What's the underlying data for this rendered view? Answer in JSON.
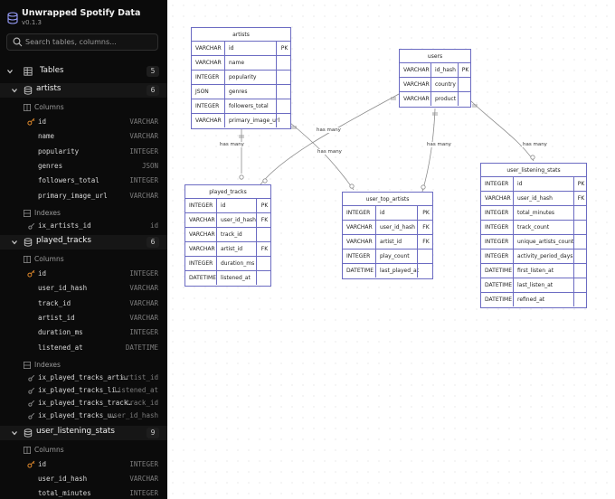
{
  "app": {
    "title": "Unwrapped Spotify Data",
    "version": "v0.1.3"
  },
  "search": {
    "placeholder": "Search tables, columns..."
  },
  "sidebar": {
    "tables_label": "Tables",
    "tables_count": "5",
    "tables": [
      {
        "name": "artists",
        "count": "6",
        "columns_label": "Columns",
        "columns": [
          {
            "name": "id",
            "type": "VARCHAR",
            "key": true
          },
          {
            "name": "name",
            "type": "VARCHAR"
          },
          {
            "name": "popularity",
            "type": "INTEGER"
          },
          {
            "name": "genres",
            "type": "JSON"
          },
          {
            "name": "followers_total",
            "type": "INTEGER"
          },
          {
            "name": "primary_image_url",
            "type": "VARCHAR"
          }
        ],
        "indexes_label": "Indexes",
        "indexes": [
          {
            "name": "ix_artists_id",
            "target": "id"
          }
        ]
      },
      {
        "name": "played_tracks",
        "count": "6",
        "columns_label": "Columns",
        "columns": [
          {
            "name": "id",
            "type": "INTEGER",
            "key": true
          },
          {
            "name": "user_id_hash",
            "type": "VARCHAR"
          },
          {
            "name": "track_id",
            "type": "VARCHAR"
          },
          {
            "name": "artist_id",
            "type": "VARCHAR"
          },
          {
            "name": "duration_ms",
            "type": "INTEGER"
          },
          {
            "name": "listened_at",
            "type": "DATETIME"
          }
        ],
        "indexes_label": "Indexes",
        "indexes": [
          {
            "name": "ix_played_tracks_arti…",
            "target": "artist_id"
          },
          {
            "name": "ix_played_tracks_li…",
            "target": "listened_at"
          },
          {
            "name": "ix_played_tracks_track…",
            "target": "track_id"
          },
          {
            "name": "ix_played_tracks_u…",
            "target": "user_id_hash"
          }
        ]
      },
      {
        "name": "user_listening_stats",
        "count": "9",
        "columns_label": "Columns",
        "columns": [
          {
            "name": "id",
            "type": "INTEGER",
            "key": true
          },
          {
            "name": "user_id_hash",
            "type": "VARCHAR"
          },
          {
            "name": "total_minutes",
            "type": "INTEGER"
          }
        ]
      }
    ]
  },
  "diagram": {
    "entities": {
      "artists": {
        "title": "artists",
        "rows": [
          [
            "VARCHAR",
            "id",
            "PK"
          ],
          [
            "VARCHAR",
            "name",
            ""
          ],
          [
            "INTEGER",
            "popularity",
            ""
          ],
          [
            "JSON",
            "genres",
            ""
          ],
          [
            "INTEGER",
            "followers_total",
            ""
          ],
          [
            "VARCHAR",
            "primary_image_url",
            ""
          ]
        ]
      },
      "users": {
        "title": "users",
        "rows": [
          [
            "VARCHAR",
            "id_hash",
            "PK"
          ],
          [
            "VARCHAR",
            "country",
            ""
          ],
          [
            "VARCHAR",
            "product",
            ""
          ]
        ]
      },
      "played_tracks": {
        "title": "played_tracks",
        "rows": [
          [
            "INTEGER",
            "id",
            "PK"
          ],
          [
            "VARCHAR",
            "user_id_hash",
            "FK"
          ],
          [
            "VARCHAR",
            "track_id",
            ""
          ],
          [
            "VARCHAR",
            "artist_id",
            "FK"
          ],
          [
            "INTEGER",
            "duration_ms",
            ""
          ],
          [
            "DATETIME",
            "listened_at",
            ""
          ]
        ]
      },
      "user_top_artists": {
        "title": "user_top_artists",
        "rows": [
          [
            "INTEGER",
            "id",
            "PK"
          ],
          [
            "VARCHAR",
            "user_id_hash",
            "FK"
          ],
          [
            "VARCHAR",
            "artist_id",
            "FK"
          ],
          [
            "INTEGER",
            "play_count",
            ""
          ],
          [
            "DATETIME",
            "last_played_at",
            ""
          ]
        ]
      },
      "user_listening_stats": {
        "title": "user_listening_stats",
        "rows": [
          [
            "INTEGER",
            "id",
            "PK"
          ],
          [
            "VARCHAR",
            "user_id_hash",
            "FK"
          ],
          [
            "INTEGER",
            "total_minutes",
            ""
          ],
          [
            "INTEGER",
            "track_count",
            ""
          ],
          [
            "INTEGER",
            "unique_artists_count",
            ""
          ],
          [
            "INTEGER",
            "activity_period_days",
            ""
          ],
          [
            "DATETIME",
            "first_listen_at",
            ""
          ],
          [
            "DATETIME",
            "last_listen_at",
            ""
          ],
          [
            "DATETIME",
            "refined_at",
            ""
          ]
        ]
      }
    },
    "relation_label": "has many",
    "colors": {
      "entity_border": "#6b6bc2",
      "edge": "#8c8c8c",
      "sidebar_bg": "#0b0b0b"
    }
  }
}
